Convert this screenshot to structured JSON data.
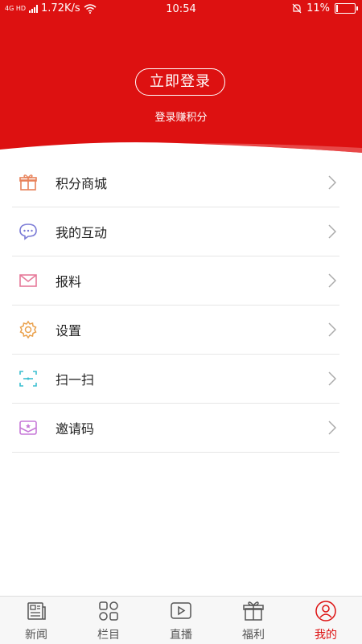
{
  "status_bar": {
    "network": "4G HD",
    "speed": "1.72K/s",
    "time": "10:54",
    "battery": "11%",
    "battery_level": 0.11
  },
  "header": {
    "login_button": "立即登录",
    "subtitle": "登录赚积分",
    "bg_color": "#dd1111"
  },
  "menu": {
    "items": [
      {
        "label": "积分商城",
        "icon": "gift-icon",
        "color": "#e8825a"
      },
      {
        "label": "我的互动",
        "icon": "chat-bubble-icon",
        "color": "#7b7bd6"
      },
      {
        "label": "报料",
        "icon": "envelope-icon",
        "color": "#e67a9a"
      },
      {
        "label": "设置",
        "icon": "gear-icon",
        "color": "#eaa24e"
      },
      {
        "label": "扫一扫",
        "icon": "scan-icon",
        "color": "#3cbfd0"
      },
      {
        "label": "邀请码",
        "icon": "invite-card-icon",
        "color": "#c77ad8"
      }
    ]
  },
  "tabbar": {
    "tabs": [
      {
        "label": "新闻",
        "icon": "news-icon"
      },
      {
        "label": "栏目",
        "icon": "grid-icon"
      },
      {
        "label": "直播",
        "icon": "play-icon"
      },
      {
        "label": "福利",
        "icon": "gift-icon"
      },
      {
        "label": "我的",
        "icon": "user-icon",
        "active": true
      }
    ],
    "active_color": "#dd1111"
  }
}
